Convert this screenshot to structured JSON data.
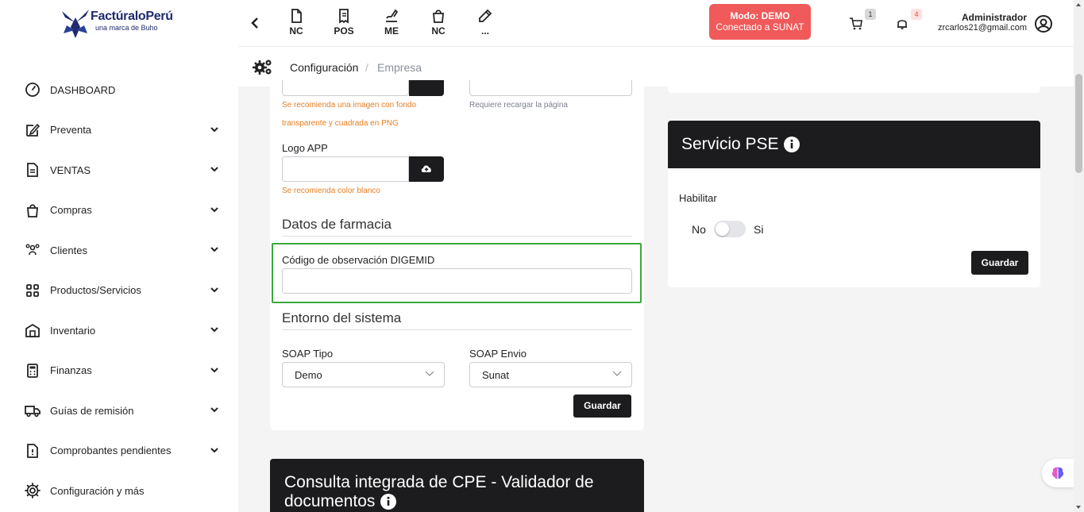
{
  "brand": {
    "name": "FactúraloPerú",
    "subtitle": "una marca de Buho"
  },
  "sidebar": {
    "items": [
      {
        "label": "DASHBOARD",
        "icon": "dashboard-gauge-icon",
        "has_chevron": false
      },
      {
        "label": "Preventa",
        "icon": "edit-icon",
        "has_chevron": true
      },
      {
        "label": "VENTAS",
        "icon": "document-icon",
        "has_chevron": true
      },
      {
        "label": "Compras",
        "icon": "shopping-bag-icon",
        "has_chevron": true
      },
      {
        "label": "Clientes",
        "icon": "users-icon",
        "has_chevron": true
      },
      {
        "label": "Productos/Servicios",
        "icon": "grid-icon",
        "has_chevron": true
      },
      {
        "label": "Inventario",
        "icon": "warehouse-icon",
        "has_chevron": true
      },
      {
        "label": "Finanzas",
        "icon": "calculator-icon",
        "has_chevron": true
      },
      {
        "label": "Guías de remisión",
        "icon": "truck-icon",
        "has_chevron": true
      },
      {
        "label": "Comprobantes pendientes",
        "icon": "pending-doc-icon",
        "has_chevron": true
      },
      {
        "label": "Configuración y más",
        "icon": "gear-icon",
        "has_chevron": false
      }
    ]
  },
  "topbar": {
    "shortcuts": [
      {
        "label": "NC",
        "icon": "note-icon"
      },
      {
        "label": "POS",
        "icon": "receipt-icon"
      },
      {
        "label": "ME",
        "icon": "signature-icon"
      },
      {
        "label": "NC",
        "icon": "bag-icon"
      },
      {
        "label": "...",
        "icon": "pencil-icon"
      }
    ],
    "mode_line1": "Modo: DEMO",
    "mode_line2": "Conectado a SUNAT",
    "cart_count": "1",
    "notif_count": "4",
    "user_name": "Administrador",
    "user_email": "zrcarlos21@gmail.com"
  },
  "breadcrumb": {
    "first": "Configuración",
    "separator": "/",
    "second": "Empresa"
  },
  "form": {
    "logo_hint_line1": "Se recomienda una imagen con fondo",
    "logo_hint_line2": "transparente y cuadrada en PNG",
    "reload_hint": "Requiere recargar la página",
    "logo_app_label": "Logo APP",
    "logo_app_value": "",
    "logo_app_hint": "Se recomienda color blanco",
    "pharmacy_section": "Datos de farmacia",
    "digemid_label": "Código de observación DIGEMID",
    "digemid_value": "",
    "env_section": "Entorno del sistema",
    "soap_type_label": "SOAP Tipo",
    "soap_type_value": "Demo",
    "soap_send_label": "SOAP Envio",
    "soap_send_value": "Sunat",
    "save_label": "Guardar"
  },
  "pse": {
    "title": "Servicio PSE",
    "enable_label": "Habilitar",
    "no_label": "No",
    "yes_label": "Si",
    "enabled": false,
    "save_label": "Guardar"
  },
  "cpe": {
    "title": "Consulta integrada de CPE - Validador de documentos"
  },
  "colors": {
    "accent_dark": "#1c1c1e",
    "mode_badge": "#f05a5a",
    "hint_orange": "#e67e22",
    "focus_green": "#3aa83a"
  }
}
